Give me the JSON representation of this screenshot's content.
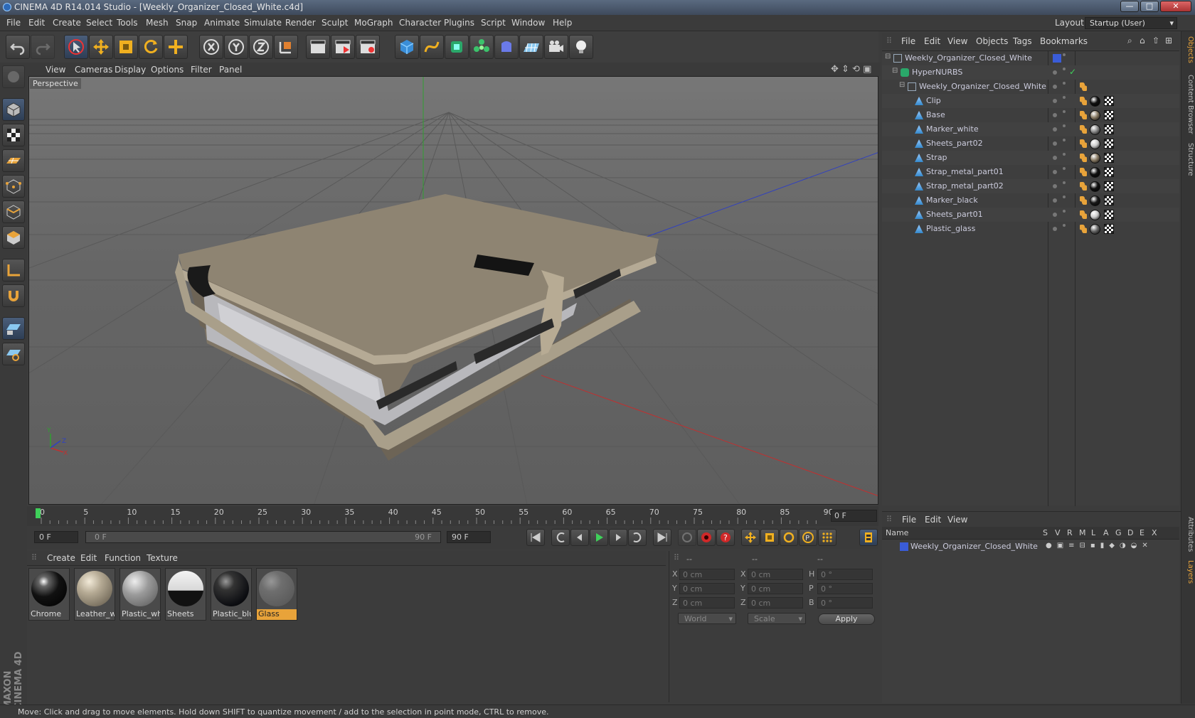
{
  "window": {
    "title": "CINEMA 4D R14.014 Studio - [Weekly_Organizer_Closed_White.c4d]",
    "minimize": "—",
    "maximize": "□",
    "close": "✕"
  },
  "menubar": {
    "items": [
      "File",
      "Edit",
      "Create",
      "Select",
      "Tools",
      "Mesh",
      "Snap",
      "Animate",
      "Simulate",
      "Render",
      "Sculpt",
      "MoGraph",
      "Character",
      "Plugins",
      "Script",
      "Window",
      "Help"
    ],
    "layout_label": "Layout:",
    "layout_value": "Startup (User)"
  },
  "viewport": {
    "menu": [
      "View",
      "Cameras",
      "Display",
      "Options",
      "Filter",
      "Panel"
    ],
    "label": "Perspective",
    "axis_x": "X",
    "axis_y": "Y",
    "axis_z": "Z"
  },
  "timeline": {
    "ticks": [
      "0",
      "5",
      "10",
      "15",
      "20",
      "25",
      "30",
      "35",
      "40",
      "45",
      "50",
      "55",
      "60",
      "65",
      "70",
      "75",
      "80",
      "85",
      "90"
    ],
    "current_frame": "0 F",
    "start_field": "0 F",
    "range_start": "0 F",
    "range_end": "90 F",
    "end_field": "90 F"
  },
  "materials": {
    "menu": [
      "Create",
      "Edit",
      "Function",
      "Texture"
    ],
    "items": [
      {
        "name": "Chrome",
        "color": "#1a1a1a"
      },
      {
        "name": "Leather_wh",
        "color": "#a89e8c"
      },
      {
        "name": "Plastic_whi",
        "color": "#9a9a9a"
      },
      {
        "name": "Sheets",
        "color": "#d8d8d8"
      },
      {
        "name": "Plastic_blu",
        "color": "#202226"
      },
      {
        "name": "Glass",
        "color": "#6a6a6a",
        "selected": true
      }
    ]
  },
  "coords": {
    "header1": "--",
    "header2": "--",
    "header3": "--",
    "rows": [
      {
        "a": "X",
        "av": "0 cm",
        "b": "X",
        "bv": "0 cm",
        "c": "H",
        "cv": "0 °"
      },
      {
        "a": "Y",
        "av": "0 cm",
        "b": "Y",
        "bv": "0 cm",
        "c": "P",
        "cv": "0 °"
      },
      {
        "a": "Z",
        "av": "0 cm",
        "b": "Z",
        "bv": "0 cm",
        "c": "B",
        "cv": "0 °"
      }
    ],
    "world": "World",
    "scale": "Scale",
    "apply": "Apply"
  },
  "status": "Move: Click and drag to move elements. Hold down SHIFT to quantize movement / add to the selection in point mode, CTRL to remove.",
  "objects": {
    "menu": [
      "File",
      "Edit",
      "View",
      "Objects",
      "Tags",
      "Bookmarks"
    ],
    "rows": [
      {
        "name": "Weekly_Organizer_Closed_White",
        "level": 0,
        "type": "null"
      },
      {
        "name": "HyperNURBS",
        "level": 1,
        "type": "nurbs"
      },
      {
        "name": "Weekly_Organizer_Closed_White",
        "level": 2,
        "type": "null"
      },
      {
        "name": "Clip",
        "level": 3,
        "type": "poly",
        "mat": "#111"
      },
      {
        "name": "Base",
        "level": 3,
        "type": "poly",
        "mat": "#8a7c66"
      },
      {
        "name": "Marker_white",
        "level": 3,
        "type": "poly",
        "mat": "#888"
      },
      {
        "name": "Sheets_part02",
        "level": 3,
        "type": "poly",
        "mat": "#ccc"
      },
      {
        "name": "Strap",
        "level": 3,
        "type": "poly",
        "mat": "#8a7c66"
      },
      {
        "name": "Strap_metal_part01",
        "level": 3,
        "type": "poly",
        "mat": "#111"
      },
      {
        "name": "Strap_metal_part02",
        "level": 3,
        "type": "poly",
        "mat": "#111"
      },
      {
        "name": "Marker_black",
        "level": 3,
        "type": "poly",
        "mat": "#1a1a1a"
      },
      {
        "name": "Sheets_part01",
        "level": 3,
        "type": "poly",
        "mat": "#ccc"
      },
      {
        "name": "Plastic_glass",
        "level": 3,
        "type": "poly",
        "mat": "#666"
      }
    ]
  },
  "layers": {
    "menu": [
      "File",
      "Edit",
      "View"
    ],
    "headers": [
      "Name",
      "S",
      "V",
      "R",
      "M",
      "L",
      "A",
      "G",
      "D",
      "E",
      "X"
    ],
    "rows": [
      {
        "name": "Weekly_Organizer_Closed_White",
        "color": "#3a5cd8"
      }
    ]
  },
  "side_tabs": [
    "Objects",
    "Content Browser",
    "Structure",
    "Attributes",
    "Layers"
  ],
  "brand": "MAXON CINEMA 4D",
  "colors": {
    "accent_orange": "#e8a33a",
    "selection_blue": "#3a5cd8",
    "axis_x": "#c03030",
    "axis_y": "#30a030",
    "axis_z": "#3040c0"
  }
}
